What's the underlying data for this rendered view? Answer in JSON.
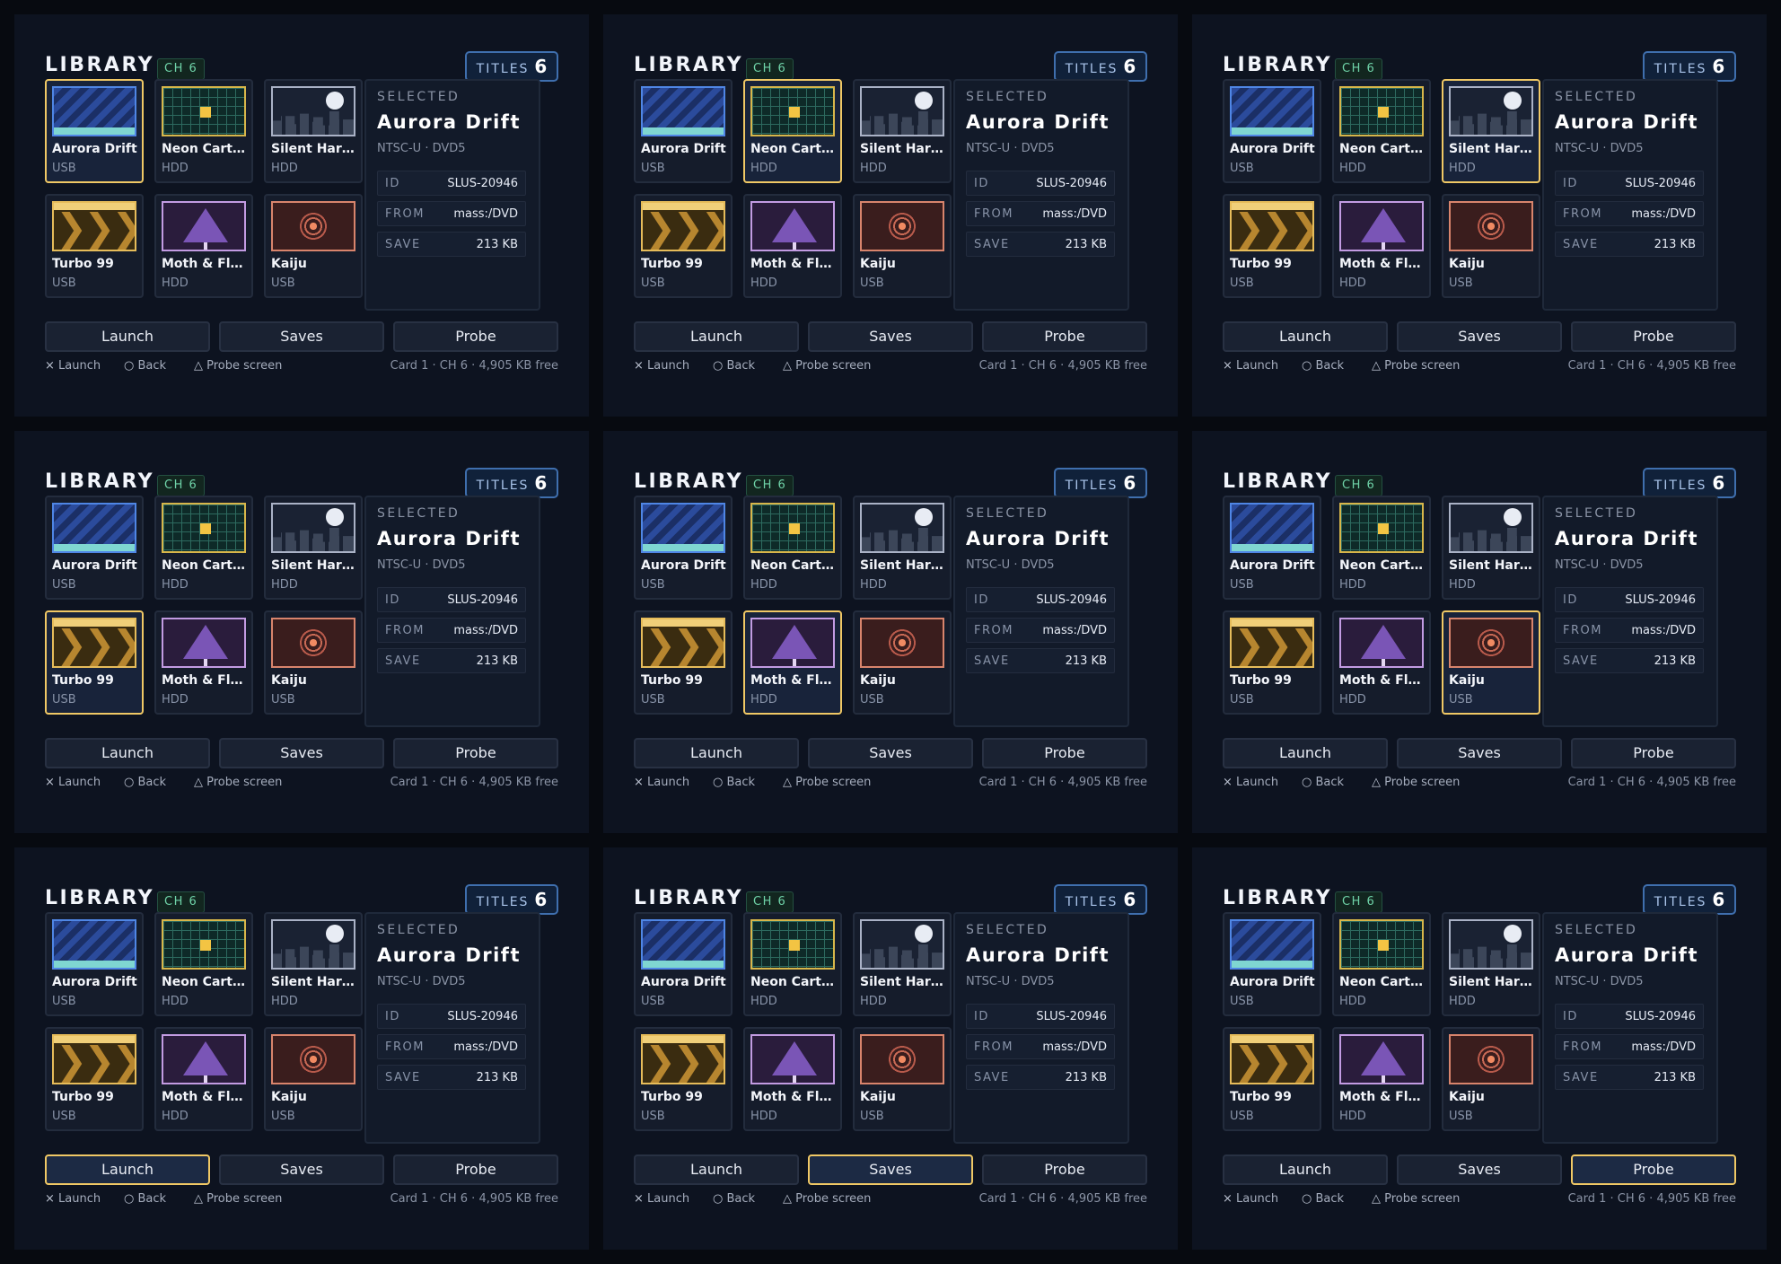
{
  "colors": {
    "background": "#070a10",
    "panel": "#0d1320",
    "focus_outline": "#f0c865",
    "titles_badge_border": "#3f6fae",
    "channel_badge_text": "#6fd3a8"
  },
  "library": {
    "title": "LIBRARY",
    "channel_badge": "CH 6",
    "titles_label": "TITLES",
    "titles_count": "6"
  },
  "games": [
    {
      "name": "Aurora Drift",
      "display": "Aurora Drift",
      "source": "USB",
      "art": "aurora"
    },
    {
      "name": "Neon Cartography",
      "display": "Neon Cart…",
      "source": "HDD",
      "art": "neon"
    },
    {
      "name": "Silent Harbor",
      "display": "Silent Har…",
      "source": "HDD",
      "art": "silent"
    },
    {
      "name": "Turbo 99",
      "display": "Turbo 99",
      "source": "USB",
      "art": "turbo"
    },
    {
      "name": "Moth & Flame",
      "display": "Moth & Fl…",
      "source": "HDD",
      "art": "moth"
    },
    {
      "name": "Kaiju",
      "display": "Kaiju",
      "source": "USB",
      "art": "kaiju"
    }
  ],
  "selected": {
    "label": "SELECTED",
    "title": "Aurora Drift",
    "meta": "NTSC-U · DVD5",
    "details": [
      {
        "key": "ID",
        "value": "SLUS-20946"
      },
      {
        "key": "FROM",
        "value": "mass:/DVD"
      },
      {
        "key": "SAVE",
        "value": "213 KB"
      }
    ]
  },
  "actions": [
    "Launch",
    "Saves",
    "Probe"
  ],
  "hints": [
    {
      "glyph": "×",
      "label": "Launch"
    },
    {
      "glyph": "○",
      "label": "Back"
    },
    {
      "glyph": "△",
      "label": "Probe screen"
    }
  ],
  "status": "Card 1 · CH 6 · 4,905 KB free",
  "panels": [
    {
      "focus_type": "tile",
      "focus_index": 0
    },
    {
      "focus_type": "tile",
      "focus_index": 1
    },
    {
      "focus_type": "tile",
      "focus_index": 2
    },
    {
      "focus_type": "tile",
      "focus_index": 3
    },
    {
      "focus_type": "tile",
      "focus_index": 4
    },
    {
      "focus_type": "tile",
      "focus_index": 5
    },
    {
      "focus_type": "button",
      "focus_index": 0
    },
    {
      "focus_type": "button",
      "focus_index": 1
    },
    {
      "focus_type": "button",
      "focus_index": 2
    }
  ]
}
